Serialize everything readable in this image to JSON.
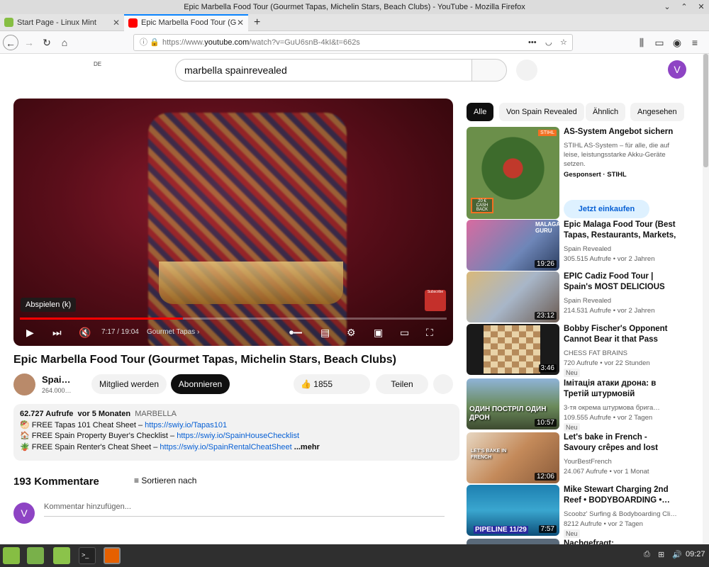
{
  "window": {
    "title": "Epic Marbella Food Tour (Gourmet Tapas, Michelin Stars, Beach Clubs) - YouTube - Mozilla Firefox"
  },
  "tabs": [
    {
      "label": "Start Page - Linux Mint",
      "active": false
    },
    {
      "label": "Epic Marbella Food Tour (G",
      "active": true
    }
  ],
  "url": {
    "prefix": "https://www.",
    "host": "youtube.com",
    "rest": "/watch?v=GuU6snB-4kI&t=662s"
  },
  "yt": {
    "region": "DE",
    "search_value": "marbella spainrevealed",
    "avatar_letter": "V"
  },
  "player": {
    "tooltip": "Abspielen (k)",
    "time": "7:17 / 19:04",
    "chapter": "Gourmet Tapas",
    "progress": 0.382,
    "subscribe_overlay": "Subscribe"
  },
  "video": {
    "title": "Epic Marbella Food Tour (Gourmet Tapas, Michelin Stars, Beach Clubs)",
    "channel": "Spai…",
    "subs": "264.000…",
    "join": "Mitglied werden",
    "subscribe": "Abonnieren",
    "likes": "1855",
    "share": "Teilen"
  },
  "description": {
    "views": "62.727 Aufrufe",
    "age": "vor 5 Monaten",
    "tag": "MARBELLA",
    "lines": [
      {
        "text": "FREE Tapas 101 Cheat Sheet – ",
        "link": "https://swiy.io/Tapas101"
      },
      {
        "text": "FREE Spain Property Buyer's Checklist – ",
        "link": "https://swiy.io/SpainHouseChecklist"
      },
      {
        "text": "FREE Spain Renter's Cheat Sheet – ",
        "link": "https://swiy.io/SpainRentalCheatSheet"
      }
    ],
    "more": "...mehr"
  },
  "comments": {
    "count": "193 Kommentare",
    "sort": "Sortieren nach",
    "placeholder": "Kommentar hinzufügen..."
  },
  "chips": [
    "Alle",
    "Von Spain Revealed",
    "Ähnlich",
    "Angesehen"
  ],
  "ad": {
    "title": "AS-System Angebot sichern",
    "text": "STIHL AS-System – für alle, die auf leise, leistungsstarke Akku-Geräte setzen.",
    "sponsored": "Gesponsert · STIHL",
    "cta": "Jetzt einkaufen",
    "badge": "STIHL",
    "cashback": "20 € CASH BACK"
  },
  "recs": [
    {
      "title": "Epic Malaga Food Tour (Best Tapas, Restaurants, Markets, …",
      "channel": "Spain Revealed",
      "meta": "305.515 Aufrufe • vor 2 Jahren",
      "duration": "19:26",
      "new": ""
    },
    {
      "title": "EPIC Cadiz Food Tour | Spain's MOST DELICIOUS City?",
      "channel": "Spain Revealed",
      "meta": "214.531 Aufrufe • vor 2 Jahren",
      "duration": "23:12",
      "new": ""
    },
    {
      "title": "Bobby Fischer's Opponent Cannot Bear it that Pass Pawn…",
      "channel": "CHESS FAT BRAINS",
      "meta": "720 Aufrufe • vor 22 Stunden",
      "duration": "3:46",
      "new": "Neu"
    },
    {
      "title": "Імітація атаки дрона: в Третій штурмовій перевірили, чим…",
      "channel": "3-тя окрема штурмова брига…",
      "meta": "109.555 Aufrufe • vor 2 Tagen",
      "duration": "10:57",
      "new": "Neu"
    },
    {
      "title": "Let's bake in French - Savoury crêpes and lost bread (French…",
      "channel": "YourBestFrench",
      "meta": "24.067 Aufrufe • vor 1 Monat",
      "duration": "12:06",
      "new": ""
    },
    {
      "title": "Mike Stewart Charging 2nd Reef • BODYBOARDING •…",
      "channel": "Scoobz' Surfing & Bodyboarding Cli…",
      "meta": "8212 Aufrufe • vor 2 Tagen",
      "duration": "7:57",
      "new": "Neu"
    },
    {
      "title": "Nachgefragt: Panzergeneral…",
      "channel": "",
      "meta": "",
      "duration": "",
      "new": ""
    }
  ],
  "thumb_text": {
    "r0": "MALAGA GURU",
    "r3": "ОДИН ПОСТРІЛ ОДИН ДРОН",
    "r4": "LET'S BAKE IN FRENCH",
    "r5": "PIPELINE 11/29"
  },
  "taskbar": {
    "clock": "09:27"
  },
  "colors": {
    "accent": "#0a84ff",
    "yt_red": "#ff0000",
    "link": "#065fd4"
  }
}
